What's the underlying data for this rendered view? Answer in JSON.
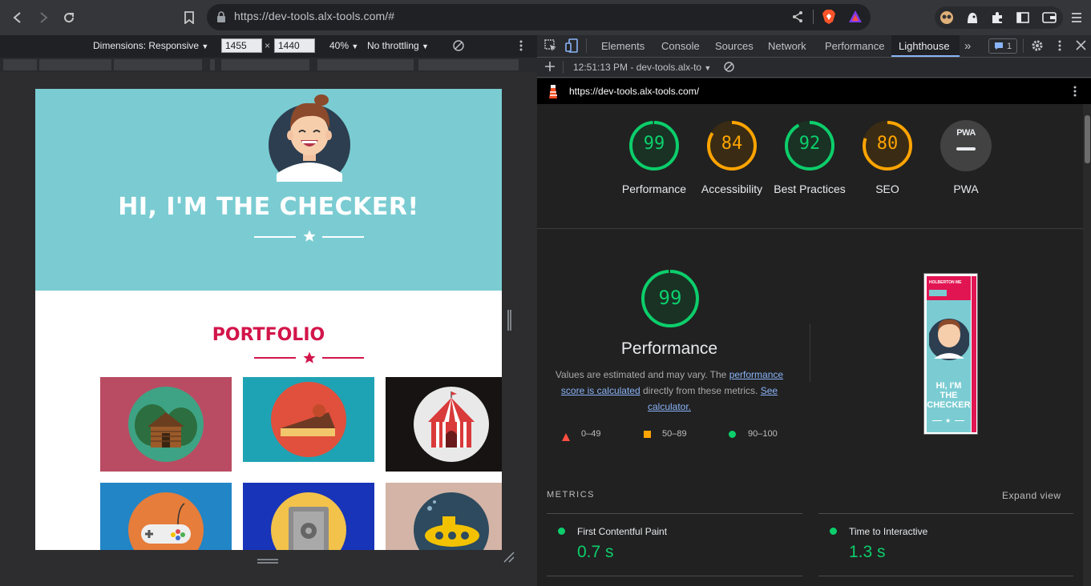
{
  "browser": {
    "url": "https://dev-tools.alx-tools.com/#"
  },
  "device_toolbar": {
    "dimensions_label": "Dimensions: Responsive",
    "width": "1455",
    "times": "×",
    "height": "1440",
    "zoom": "40%",
    "throttling": "No throttling"
  },
  "page": {
    "hero_title": "HI, I'M THE CHECKER!",
    "portfolio_title": "PORTFOLIO",
    "colors": {
      "hero_bg": "#7accd2",
      "accent": "#d2154a"
    },
    "tiles": [
      {
        "name": "cabin",
        "bg": "#b94c63"
      },
      {
        "name": "cake",
        "bg": "#1ea3b4"
      },
      {
        "name": "circus",
        "bg": "#171313"
      },
      {
        "name": "game-controller",
        "bg": "#2285c6"
      },
      {
        "name": "safe",
        "bg": "#1834b8"
      },
      {
        "name": "submarine",
        "bg": "#d3b4a6"
      }
    ]
  },
  "devtools": {
    "tabs": [
      "Elements",
      "Console",
      "Sources",
      "Network",
      "Performance",
      "Lighthouse"
    ],
    "issues_count": "1",
    "report_time": "12:51:13 PM - dev-tools.alx-to",
    "report_url": "https://dev-tools.alx-tools.com/"
  },
  "lighthouse": {
    "gauges": [
      {
        "score": 99,
        "label": "Performance",
        "color": "#0cce6b"
      },
      {
        "score": 84,
        "label": "Accessibility",
        "color": "#ffa400"
      },
      {
        "score": 92,
        "label": "Best Practices",
        "color": "#0cce6b"
      },
      {
        "score": 80,
        "label": "SEO",
        "color": "#ffa400"
      }
    ],
    "pwa": {
      "label": "PWA",
      "badge": "PWA"
    },
    "performance": {
      "score": "99",
      "title": "Performance",
      "desc_1": "Values are estimated and may vary. The",
      "desc_link_1": "performance score is calculated",
      "desc_2": "directly from these metrics.",
      "desc_link_2": "See calculator."
    },
    "legend": [
      {
        "range": "0–49",
        "color": "#ff4e42"
      },
      {
        "range": "50–89",
        "color": "#ffa400"
      },
      {
        "range": "90–100",
        "color": "#0cce6b"
      }
    ],
    "screenshot_thumb": {
      "brand": "HOLBERTON ME",
      "title": "HI, I'M THE CHECKER"
    },
    "metrics_header": "METRICS",
    "expand_view": "Expand view",
    "metrics": [
      {
        "label": "First Contentful Paint",
        "value": "0.7 s"
      },
      {
        "label": "Time to Interactive",
        "value": "1.3 s"
      }
    ]
  }
}
